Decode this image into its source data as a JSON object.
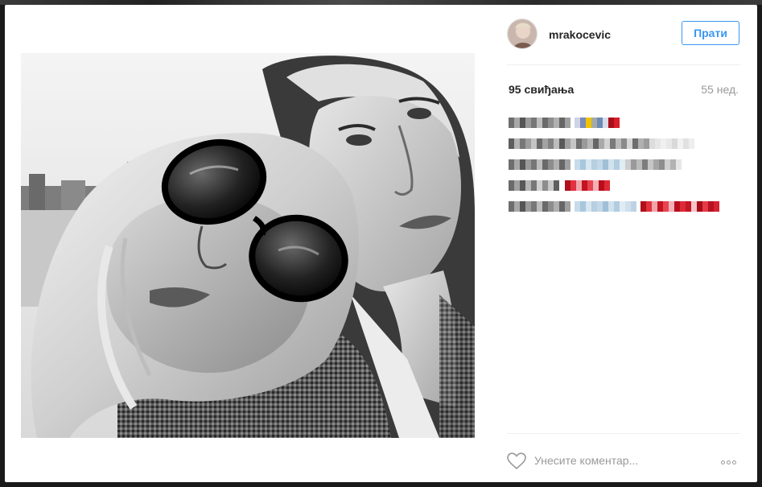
{
  "post": {
    "username": "mrakocevic",
    "follow_label": "Прати",
    "likes": "95 свиђања",
    "time": "55 нед.",
    "comment_placeholder": "Унесите коментар...",
    "more_label": "More options"
  },
  "colors": {
    "accent": "#3897f0",
    "text": "#262626",
    "muted": "#999999",
    "border": "#efefef"
  },
  "icons": {
    "like": "heart-outline-icon",
    "more": "ellipsis-icon"
  },
  "comments": [
    {
      "kind": "pixelated"
    },
    {
      "kind": "pixelated"
    },
    {
      "kind": "pixelated"
    },
    {
      "kind": "pixelated"
    },
    {
      "kind": "pixelated"
    }
  ]
}
